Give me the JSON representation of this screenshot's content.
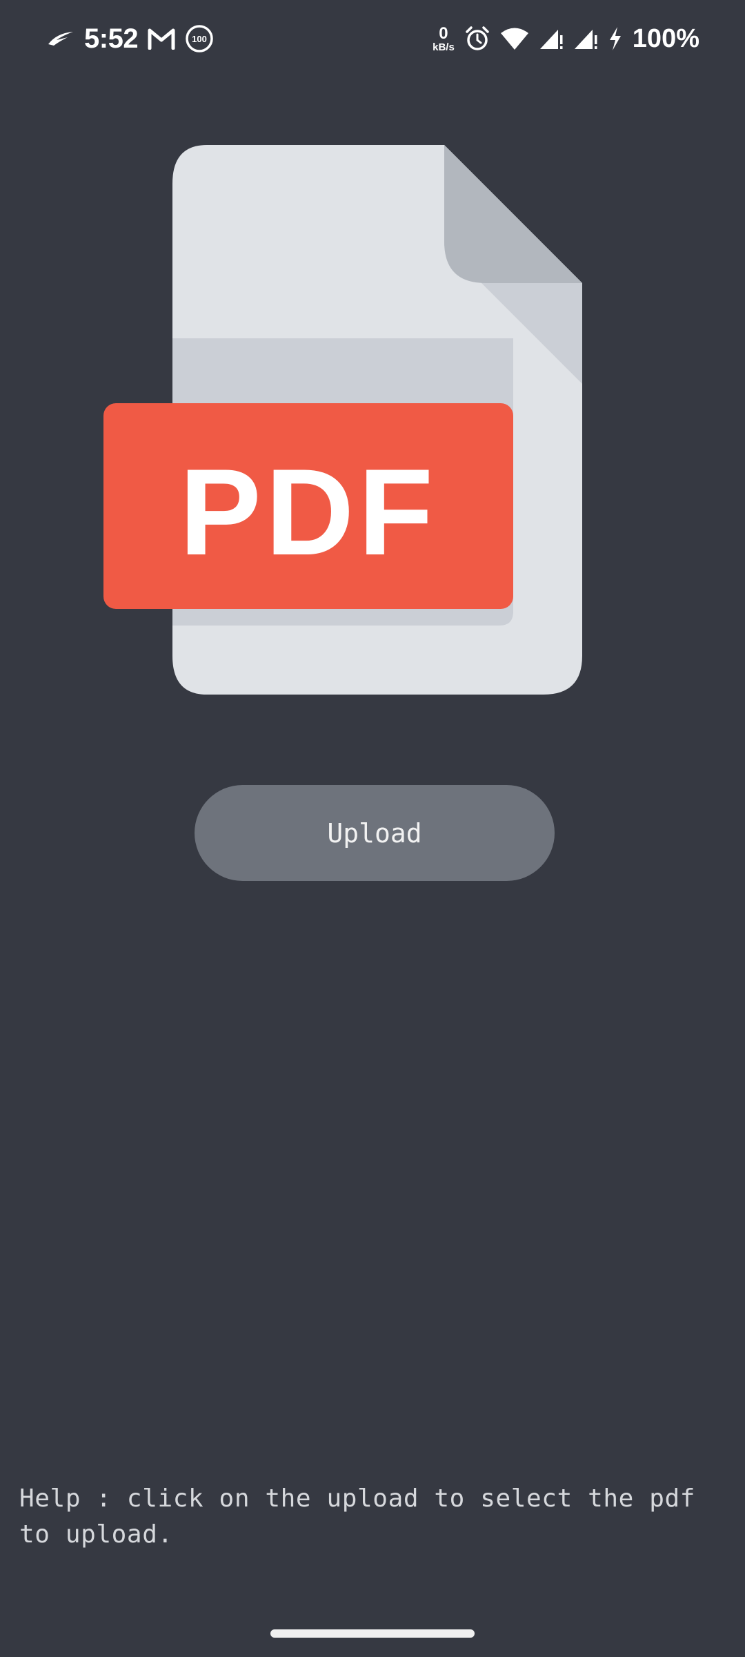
{
  "status_bar": {
    "time": "5:52",
    "net_speed_value": "0",
    "net_speed_unit": "kB/s",
    "battery": "100%",
    "notification_badge": "100",
    "icons": [
      "rog-icon",
      "gmail-icon",
      "badge-100-icon",
      "alarm-icon",
      "wifi-icon",
      "signal-icon",
      "signal-icon",
      "charging-icon"
    ]
  },
  "illustration": {
    "label": "PDF",
    "colors": {
      "page": "#e0e3e7",
      "fold": "#b2b7be",
      "fold_shadow": "#cbcfd6",
      "banner": "#f05a45",
      "banner_text": "#ffffff"
    }
  },
  "upload": {
    "label": "Upload"
  },
  "help": {
    "text": "Help : click on the upload to select the pdf to upload."
  },
  "colors": {
    "background": "#363942",
    "button": "#6e737c"
  }
}
